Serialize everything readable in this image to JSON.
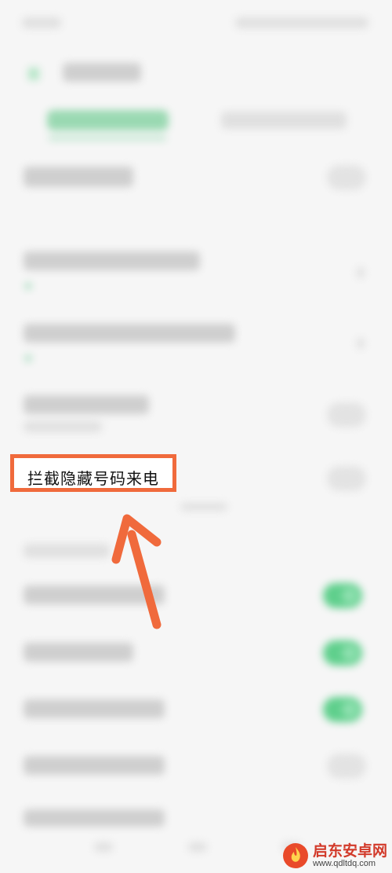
{
  "highlight": {
    "label": "拦截隐藏号码来电"
  },
  "watermark": {
    "brand": "启东安卓网",
    "url": "www.qdltdq.com",
    "logo_icon": "flame-logo-icon"
  },
  "colors": {
    "highlight_border": "#f06a3c",
    "arrow": "#f06a3c",
    "toggle_on": "#5fcf8c",
    "background": "#f6f6f6"
  },
  "toggles": {
    "rows": [
      {
        "state": "off"
      },
      {
        "state": "off"
      },
      {
        "state": "off"
      },
      {
        "state": "on"
      },
      {
        "state": "on"
      },
      {
        "state": "on"
      },
      {
        "state": "off"
      }
    ]
  }
}
